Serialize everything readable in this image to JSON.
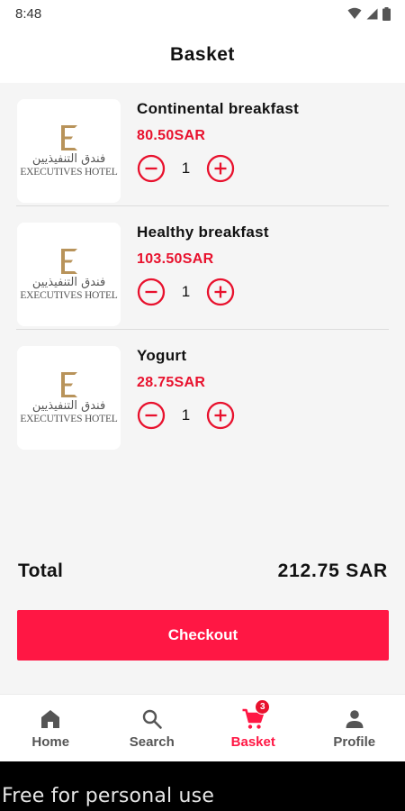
{
  "status_bar": {
    "time": "8:48"
  },
  "header": {
    "title": "Basket"
  },
  "logo": {
    "arabic_text": "فندق التنفيذيين",
    "english_text": "EXECUTIVES HOTEL"
  },
  "basket": {
    "items": [
      {
        "name": "Continental breakfast",
        "price": "80.50SAR",
        "quantity": "1"
      },
      {
        "name": "Healthy breakfast",
        "price": "103.50SAR",
        "quantity": "1"
      },
      {
        "name": "Yogurt",
        "price": "28.75SAR",
        "quantity": "1"
      }
    ]
  },
  "summary": {
    "total_label": "Total",
    "total_value": "212.75 SAR"
  },
  "checkout": {
    "label": "Checkout"
  },
  "bottom_nav": {
    "items": [
      {
        "label": "Home",
        "icon": "home-icon"
      },
      {
        "label": "Search",
        "icon": "search-icon"
      },
      {
        "label": "Basket",
        "icon": "cart-icon",
        "badge": "3"
      },
      {
        "label": "Profile",
        "icon": "person-icon"
      }
    ],
    "active": "Basket"
  },
  "footer": {
    "watermark": "Free for personal use"
  },
  "colors": {
    "accent": "#ff1744",
    "price": "#e8112d",
    "gold": "#b8935a"
  }
}
